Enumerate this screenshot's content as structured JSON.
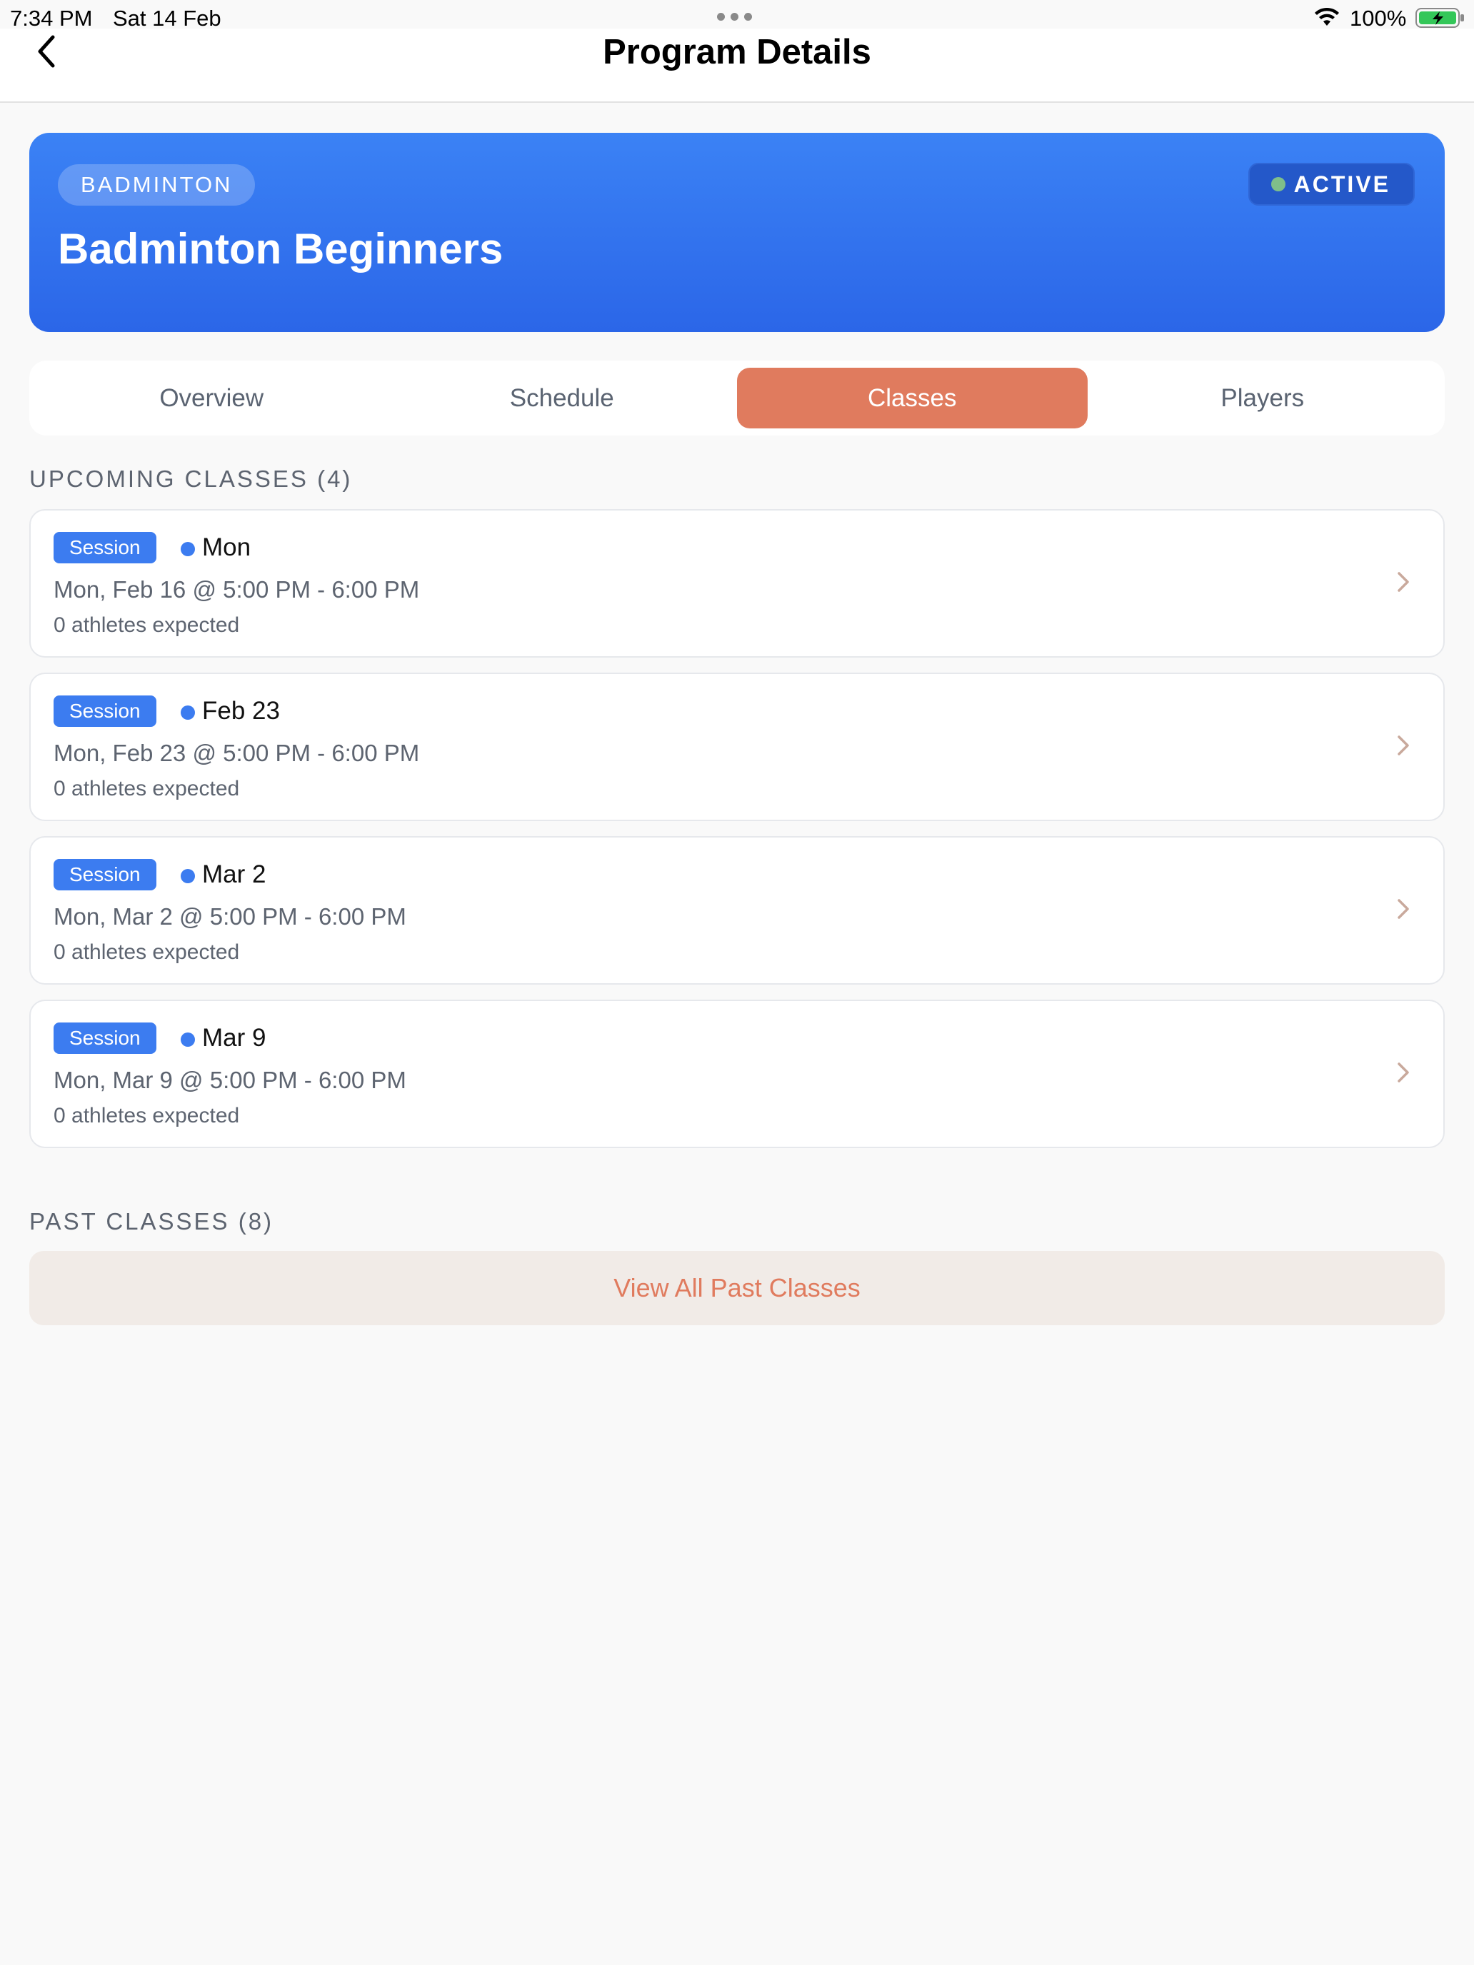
{
  "status_bar": {
    "time": "7:34 PM",
    "date": "Sat 14 Feb",
    "battery": "100%"
  },
  "nav": {
    "title": "Program Details",
    "back_icon": "chevron-left-icon"
  },
  "program": {
    "sport": "BADMINTON",
    "status": "ACTIVE",
    "name": "Badminton Beginners",
    "gradient_top": "#3b82f5",
    "gradient_bottom": "#2b66e8"
  },
  "tabs": [
    {
      "label": "Overview",
      "active": false
    },
    {
      "label": "Schedule",
      "active": false
    },
    {
      "label": "Classes",
      "active": true
    },
    {
      "label": "Players",
      "active": false
    }
  ],
  "upcoming": {
    "header": "UPCOMING CLASSES (4)",
    "classes": [
      {
        "badge": "Session",
        "day": "Mon",
        "when": "Mon, Feb 16 @ 5:00 PM - 6:00 PM",
        "count": "0 athletes expected"
      },
      {
        "badge": "Session",
        "day": "Feb 23",
        "when": "Mon, Feb 23 @ 5:00 PM - 6:00 PM",
        "count": "0 athletes expected"
      },
      {
        "badge": "Session",
        "day": "Mar 2",
        "when": "Mon, Mar 2 @ 5:00 PM - 6:00 PM",
        "count": "0 athletes expected"
      },
      {
        "badge": "Session",
        "day": "Mar 9",
        "when": "Mon, Mar 9 @ 5:00 PM - 6:00 PM",
        "count": "0 athletes expected"
      }
    ]
  },
  "past": {
    "header": "PAST CLASSES (8)",
    "button": "View All Past Classes"
  },
  "colors": {
    "accent": "#e07b5e",
    "primary": "#3c7cf0",
    "active_dot": "#7fbf8a"
  }
}
